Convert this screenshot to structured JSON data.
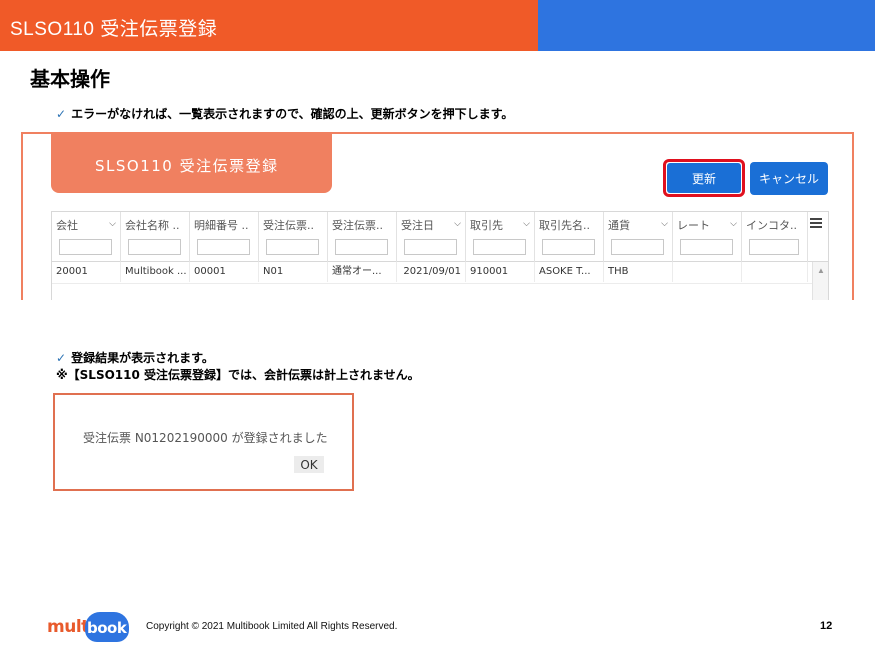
{
  "header": {
    "title": "SLSO110 受注伝票登録",
    "color_left": "#f05a28",
    "color_right": "#2e74e0"
  },
  "section_title": "基本操作",
  "note1": {
    "check": "✓",
    "text": "エラーがなければ、一覧表示されますので、確認の上、更新ボタンを押下します。"
  },
  "app": {
    "banner_title": "SLSO110 受注伝票登録",
    "update_button": "更新",
    "cancel_button": "キャンセル",
    "grid": {
      "columns": [
        "会社",
        "会社名称 ..",
        "明細番号 ..",
        "受注伝票..",
        "受注伝票..",
        "受注日",
        "取引先",
        "取引先名..",
        "通貨",
        "レート",
        "インコタ.."
      ],
      "rows": [
        [
          "20001",
          "Multibook ...",
          "00001",
          "N01",
          "通常オー...",
          "2021/09/01",
          "910001",
          "ASOKE T...",
          "THB",
          "",
          ""
        ]
      ]
    }
  },
  "note2": {
    "check": "✓",
    "line1": "登録結果が表示されます。",
    "line2": "※【SLSO110 受注伝票登録】では、会計伝票は計上されません。"
  },
  "dialog": {
    "message": "受注伝票 N01202190000 が登録されました",
    "ok_button": "OK"
  },
  "footer": {
    "logo_left": "multi",
    "logo_right": "book",
    "copyright": "Copyright © 2021 Multibook Limited All Rights Reserved.",
    "page_number": "12"
  }
}
